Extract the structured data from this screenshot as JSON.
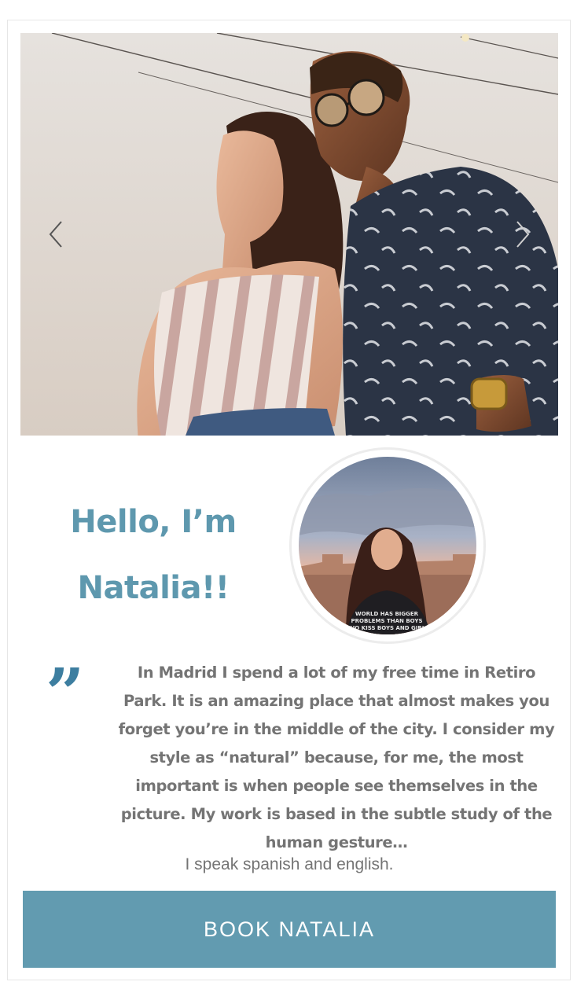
{
  "hero": {
    "image": "couple-portrait-photo",
    "prev_icon": "chevron-left-icon",
    "next_icon": "chevron-right-icon"
  },
  "profile": {
    "greeting_line1": "Hello, I’m",
    "greeting_line2": "Natalia!!",
    "avatar": "natalia-avatar-photo",
    "shirt_text": [
      "WORLD HAS BIGGER",
      "PROBLEMS THAN BOYS",
      "WHO KISS BOYS AND GIRLS"
    ]
  },
  "quote": {
    "mark": "”",
    "icon": "quote-mark-icon",
    "text": "In Madrid I spend a lot of my free time in Retiro Park. It is an amazing place that almost makes you forget you’re in the middle of the city. I consider my style as “natural” because, for me, the most important is when people see themselves in the picture. My work is based in the subtle study of the human gesture…"
  },
  "languages": "I speak spanish and english.",
  "cta": {
    "label": "BOOK NATALIA"
  },
  "colors": {
    "accent": "#629bb0",
    "heading": "#5e98ae",
    "quote_mark": "#3d7ea0",
    "body_text": "#747474",
    "border": "#e6e6e6"
  }
}
